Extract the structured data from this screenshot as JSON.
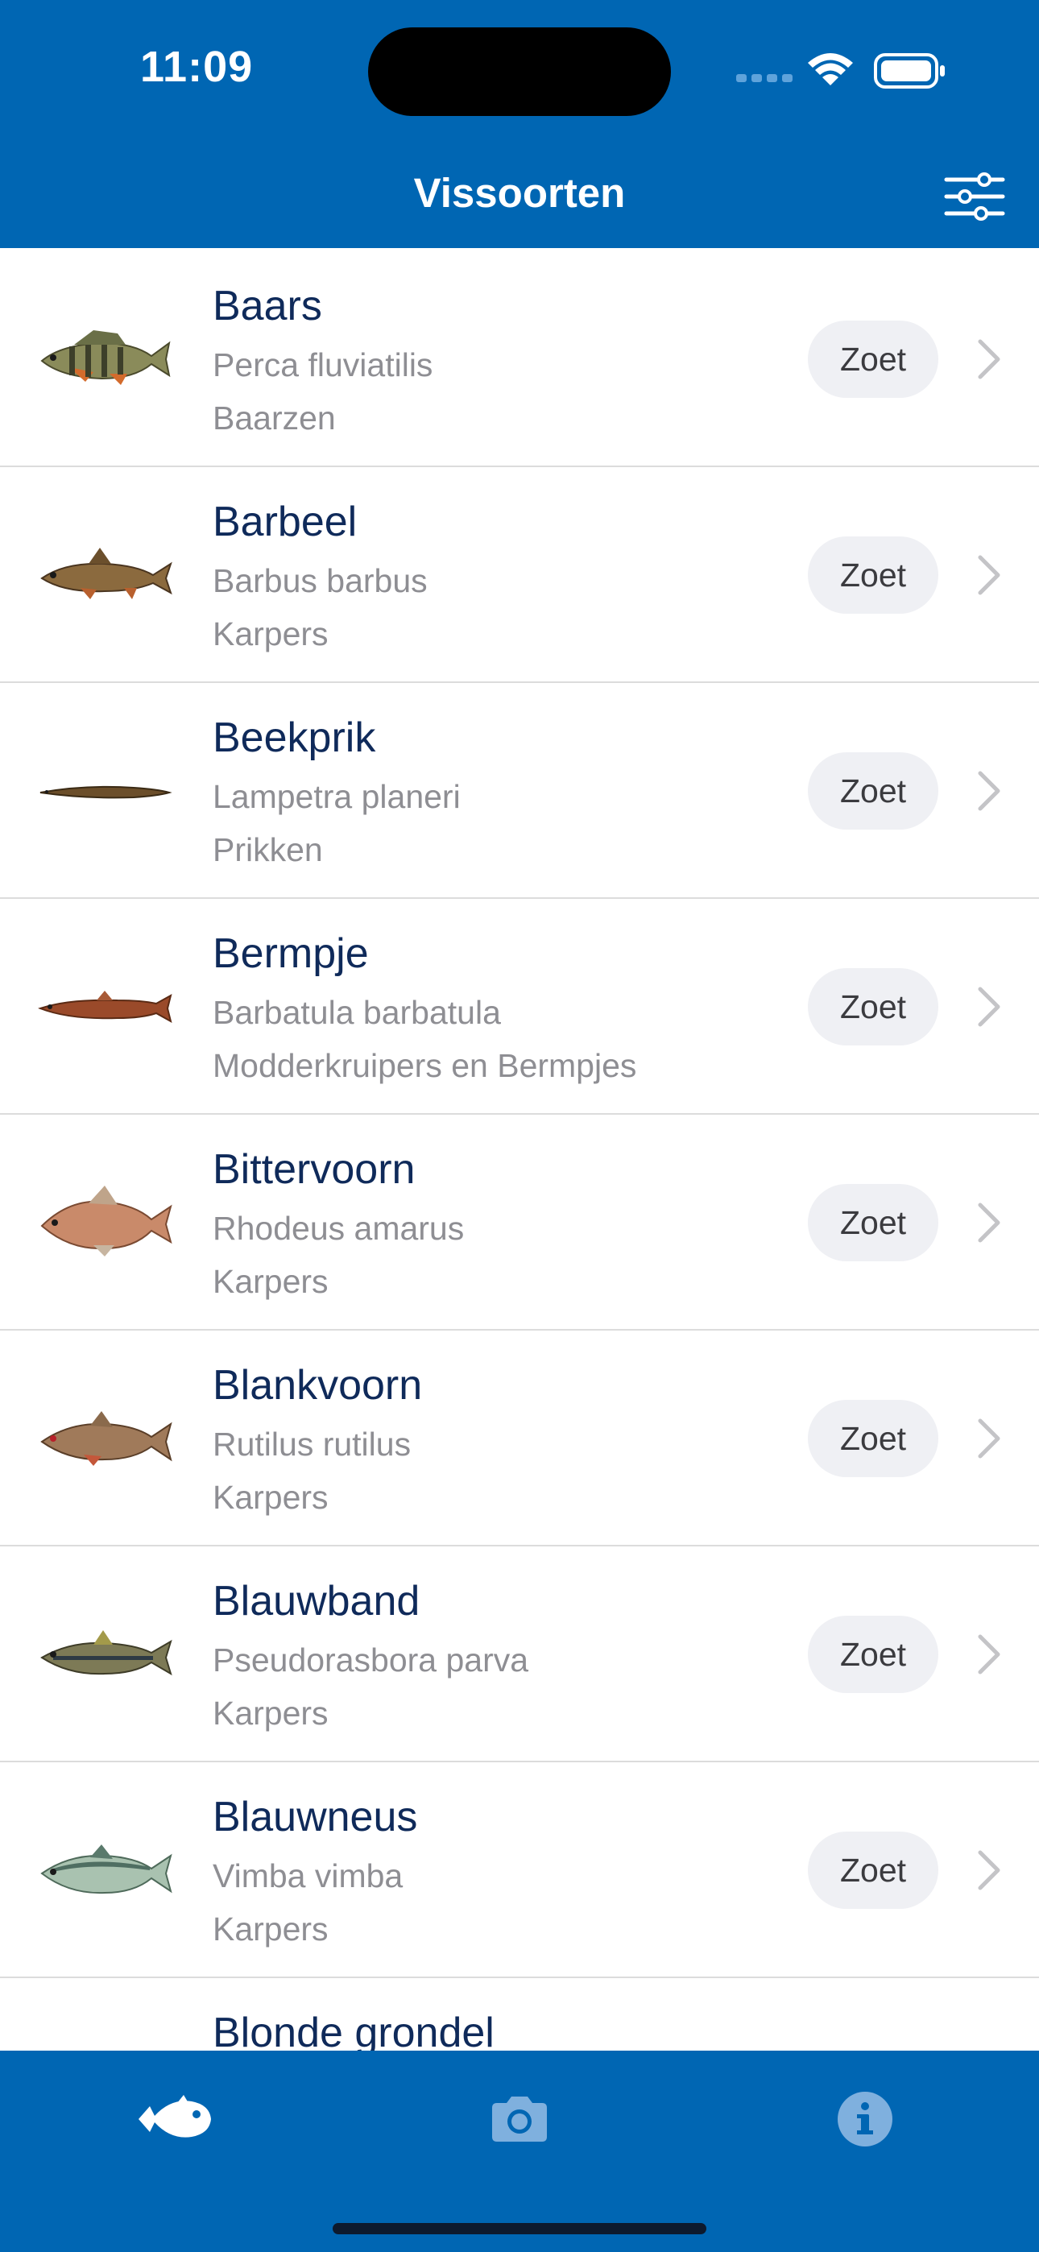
{
  "status_bar": {
    "time": "11:09"
  },
  "nav": {
    "title": "Vissoorten"
  },
  "species": [
    {
      "name": "Baars",
      "latin": "Perca fluviatilis",
      "family": "Baarzen",
      "water": "Zoet"
    },
    {
      "name": "Barbeel",
      "latin": "Barbus barbus",
      "family": "Karpers",
      "water": "Zoet"
    },
    {
      "name": "Beekprik",
      "latin": "Lampetra planeri",
      "family": "Prikken",
      "water": "Zoet"
    },
    {
      "name": "Bermpje",
      "latin": "Barbatula barbatula",
      "family": "Modderkruipers en Bermpjes",
      "water": "Zoet"
    },
    {
      "name": "Bittervoorn",
      "latin": "Rhodeus amarus",
      "family": "Karpers",
      "water": "Zoet"
    },
    {
      "name": "Blankvoorn",
      "latin": "Rutilus rutilus",
      "family": "Karpers",
      "water": "Zoet"
    },
    {
      "name": "Blauwband",
      "latin": "Pseudorasbora parva",
      "family": "Karpers",
      "water": "Zoet"
    },
    {
      "name": "Blauwneus",
      "latin": "Vimba vimba",
      "family": "Karpers",
      "water": "Zoet"
    },
    {
      "name": "Blonde grondel"
    }
  ],
  "tabs": [
    {
      "icon": "fish-icon",
      "selected": true
    },
    {
      "icon": "camera-icon",
      "selected": false
    },
    {
      "icon": "info-icon",
      "selected": false
    }
  ],
  "colors": {
    "primary": "#0066b3",
    "title_text": "#0f2a5a",
    "subtitle_text": "#8e8e93",
    "badge_bg": "#eff0f4"
  }
}
